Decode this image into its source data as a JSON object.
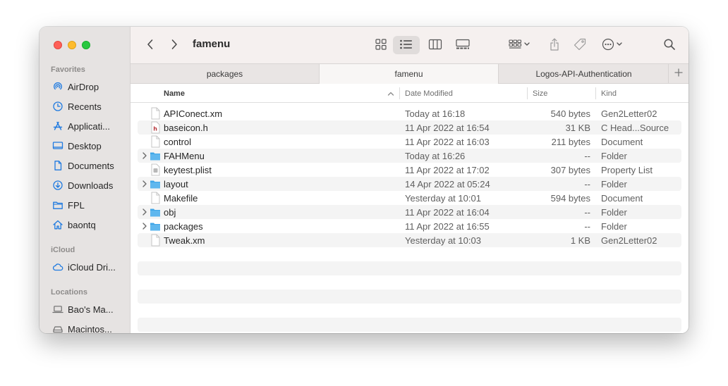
{
  "window": {
    "title": "famenu"
  },
  "sidebar": {
    "favorites_label": "Favorites",
    "icloud_label": "iCloud",
    "locations_label": "Locations",
    "favorites": [
      {
        "label": "AirDrop",
        "icon": "airdrop-icon"
      },
      {
        "label": "Recents",
        "icon": "clock-icon"
      },
      {
        "label": "Applicati...",
        "icon": "applications-icon"
      },
      {
        "label": "Desktop",
        "icon": "desktop-icon"
      },
      {
        "label": "Documents",
        "icon": "document-icon"
      },
      {
        "label": "Downloads",
        "icon": "download-icon"
      },
      {
        "label": "FPL",
        "icon": "folder-icon"
      },
      {
        "label": "baontq",
        "icon": "home-icon"
      }
    ],
    "icloud": [
      {
        "label": "iCloud Dri...",
        "icon": "cloud-icon"
      }
    ],
    "locations": [
      {
        "label": "Bao's Ma...",
        "icon": "laptop-icon"
      },
      {
        "label": "Macintos...",
        "icon": "disk-icon"
      }
    ]
  },
  "toolbar": {
    "title": "famenu",
    "view_mode": "list"
  },
  "tabs": [
    {
      "label": "packages",
      "active": false
    },
    {
      "label": "famenu",
      "active": true
    },
    {
      "label": "Logos-API-Authentication",
      "active": false
    }
  ],
  "columns": {
    "name": "Name",
    "date": "Date Modified",
    "size": "Size",
    "kind": "Kind"
  },
  "files": [
    {
      "name": "APIConect.xm",
      "date": "Today at 16:18",
      "size": "540 bytes",
      "kind": "Gen2Letter02",
      "type": "file"
    },
    {
      "name": "baseicon.h",
      "date": "11 Apr 2022 at 16:54",
      "size": "31 KB",
      "kind": "C Head...Source",
      "type": "header"
    },
    {
      "name": "control",
      "date": "11 Apr 2022 at 16:03",
      "size": "211 bytes",
      "kind": "Document",
      "type": "file"
    },
    {
      "name": "FAHMenu",
      "date": "Today at 16:26",
      "size": "--",
      "kind": "Folder",
      "type": "folder"
    },
    {
      "name": "keytest.plist",
      "date": "11 Apr 2022 at 17:02",
      "size": "307 bytes",
      "kind": "Property List",
      "type": "plist"
    },
    {
      "name": "layout",
      "date": "14 Apr 2022 at 05:24",
      "size": "--",
      "kind": "Folder",
      "type": "folder"
    },
    {
      "name": "Makefile",
      "date": "Yesterday at 10:01",
      "size": "594 bytes",
      "kind": "Document",
      "type": "file"
    },
    {
      "name": "obj",
      "date": "11 Apr 2022 at 16:04",
      "size": "--",
      "kind": "Folder",
      "type": "folder"
    },
    {
      "name": "packages",
      "date": "11 Apr 2022 at 16:55",
      "size": "--",
      "kind": "Folder",
      "type": "folder"
    },
    {
      "name": "Tweak.xm",
      "date": "Yesterday at 10:03",
      "size": "1 KB",
      "kind": "Gen2Letter02",
      "type": "file"
    }
  ],
  "colors": {
    "accent": "#1f7ae0",
    "folder": "#5fb7ee",
    "close": "#fe5f57",
    "minimize": "#febc2e",
    "zoom": "#28c840"
  }
}
